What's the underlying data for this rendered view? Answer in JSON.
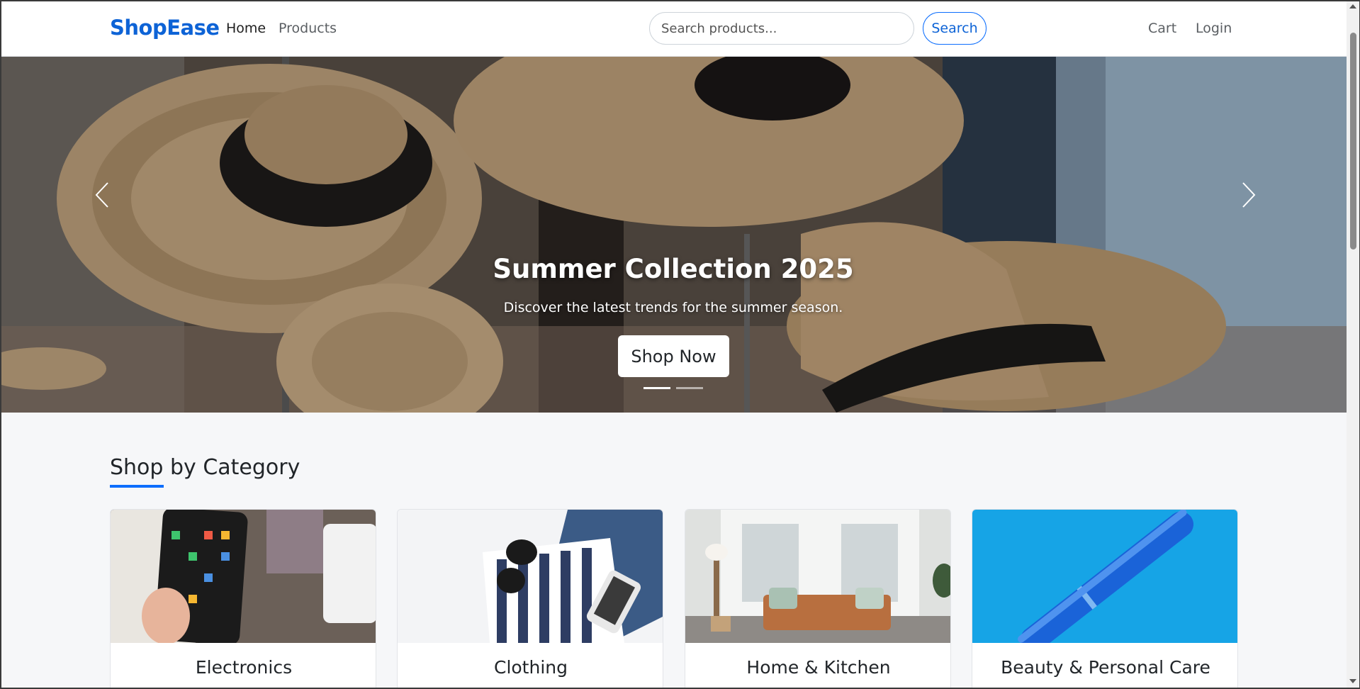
{
  "navbar": {
    "brand": "ShopEase",
    "links": {
      "home": "Home",
      "products": "Products",
      "cart": "Cart",
      "login": "Login"
    },
    "search": {
      "placeholder": "Search products...",
      "button_label": "Search"
    }
  },
  "hero": {
    "title": "Summer Collection 2025",
    "subtitle": "Discover the latest trends for the summer season.",
    "cta_label": "Shop Now",
    "slides_total": 2,
    "active_slide": 1
  },
  "categories": {
    "heading": "Shop by Category",
    "items": [
      {
        "label": "Electronics"
      },
      {
        "label": "Clothing"
      },
      {
        "label": "Home & Kitchen"
      },
      {
        "label": "Beauty & Personal Care"
      }
    ]
  },
  "colors": {
    "brand": "#0d63d6",
    "accent": "#0d6efd",
    "page_bg": "#f6f7f9"
  }
}
